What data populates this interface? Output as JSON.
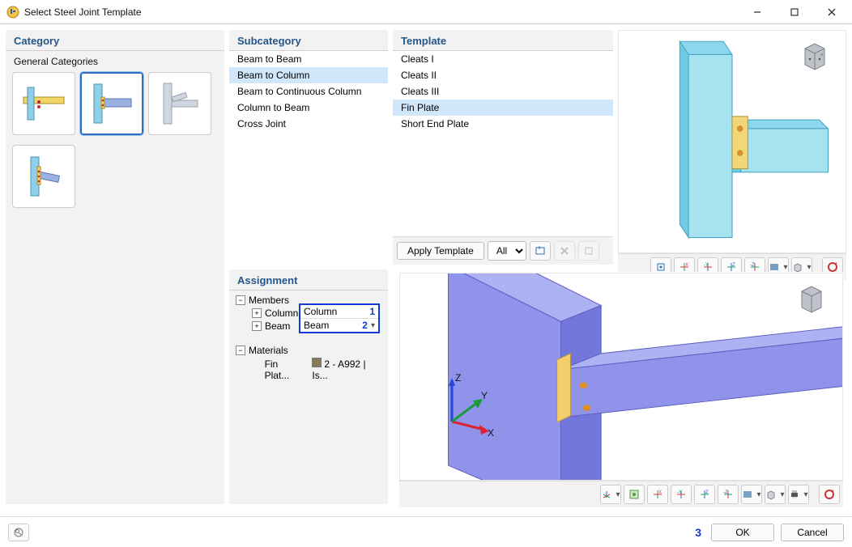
{
  "window": {
    "title": "Select Steel Joint Template"
  },
  "category": {
    "title": "Category",
    "group_label": "General Categories",
    "thumbs": [
      {
        "name": "cat-thumb-1",
        "selected": false
      },
      {
        "name": "cat-thumb-2",
        "selected": true
      },
      {
        "name": "cat-thumb-3",
        "selected": false
      },
      {
        "name": "cat-thumb-4",
        "selected": false
      }
    ]
  },
  "subcategory": {
    "title": "Subcategory",
    "items": [
      "Beam to Beam",
      "Beam to Column",
      "Beam to Continuous Column",
      "Column to Beam",
      "Cross Joint"
    ],
    "selected": "Beam to Column"
  },
  "template": {
    "title": "Template",
    "items": [
      "Cleats I",
      "Cleats II",
      "Cleats III",
      "Fin Plate",
      "Short End Plate"
    ],
    "selected": "Fin Plate",
    "apply_label": "Apply Template",
    "filter": "All"
  },
  "preview_toolbar": {
    "items": [
      "center-view-icon",
      "axis-x-icon",
      "axis-y-icon",
      "axis-z-icon",
      "axis-neg-z-icon",
      "shading-icon",
      "cube-icon"
    ],
    "reset_label": "reset-view-icon"
  },
  "assignment": {
    "title": "Assignment",
    "members_label": "Members",
    "member_items": [
      {
        "label": "Column",
        "field": "Column",
        "num": "1"
      },
      {
        "label": "Beam",
        "field": "Beam",
        "num": "2"
      }
    ],
    "materials_label": "Materials",
    "materials": [
      {
        "label": "Fin Plat...",
        "value": "2 - A992 | Is..."
      }
    ]
  },
  "lower_toolbar": {
    "items": [
      "axis-origin-icon",
      "fit-view-icon",
      "axis-x-icon",
      "axis-y-icon",
      "axis-z-icon",
      "axis-neg-z-icon",
      "shading-icon",
      "cube-icon",
      "print-icon"
    ],
    "reset_label": "reset-view-icon"
  },
  "footer": {
    "ok": "OK",
    "cancel": "Cancel",
    "hint_number": "3"
  },
  "annotations": {
    "axis_x": "X",
    "axis_y": "Y",
    "axis_z": "Z"
  }
}
